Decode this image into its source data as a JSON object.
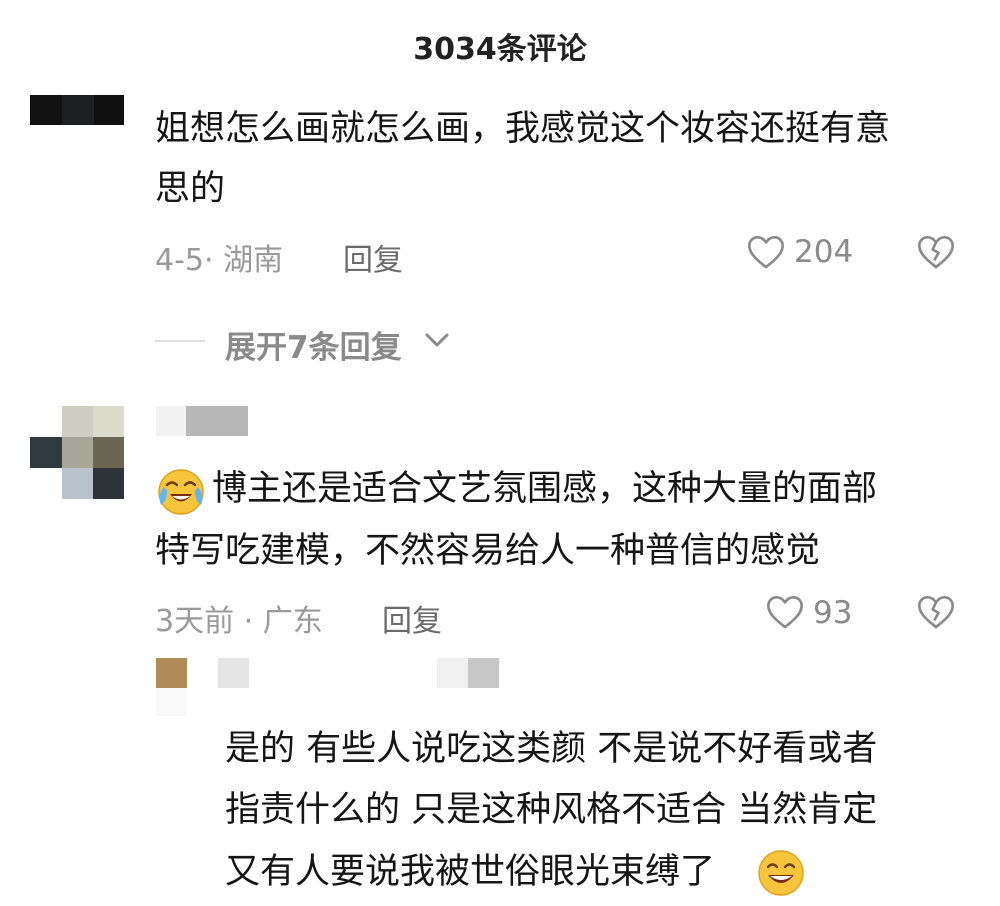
{
  "header": {
    "title": "3034条评论"
  },
  "comments": [
    {
      "text": "姐想怎么画就怎么画，我感觉这个妆容还挺有意思的",
      "line1": "姐想怎么画就怎么画，我感觉这个妆容还挺有意",
      "line2": "思的",
      "meta": "4-5· 湖南",
      "reply_label": "回复",
      "likes": "204",
      "expand_label": "展开7条回复"
    },
    {
      "text": "博主还是适合文艺氛围感，这种大量的面部特写吃建模，不然容易给人一种普信的感觉",
      "line1": "博主还是适合文艺氛围感，这种大量的面部",
      "line2": "特写吃建模，不然容易给人一种普信的感觉",
      "meta": "3天前 · 广东",
      "reply_label": "回复",
      "likes": "93",
      "reply": {
        "text": "是的 有些人说吃这类颜 不是说不好看或者指责什么的 只是这种风格不适合 当然肯定又有人要说我被世俗眼光束缚了",
        "line1": "是的 有些人说吃这类颜 不是说不好看或者",
        "line2": "指责什么的 只是这种风格不适合 当然肯定",
        "line3": "又有人要说我被世俗眼光束缚了"
      }
    }
  ],
  "icons": {
    "like": "heart-outline-icon",
    "dislike": "broken-heart-icon",
    "expand": "chevron-down-icon",
    "emoji_cry": "crying-laughing-emoji-icon",
    "emoji_grin": "grinning-sweat-emoji-icon"
  },
  "colors": {
    "text": "#161616",
    "meta": "#9a9a9a",
    "reply": "#6b6b6b",
    "icon": "#8a8a8a"
  }
}
